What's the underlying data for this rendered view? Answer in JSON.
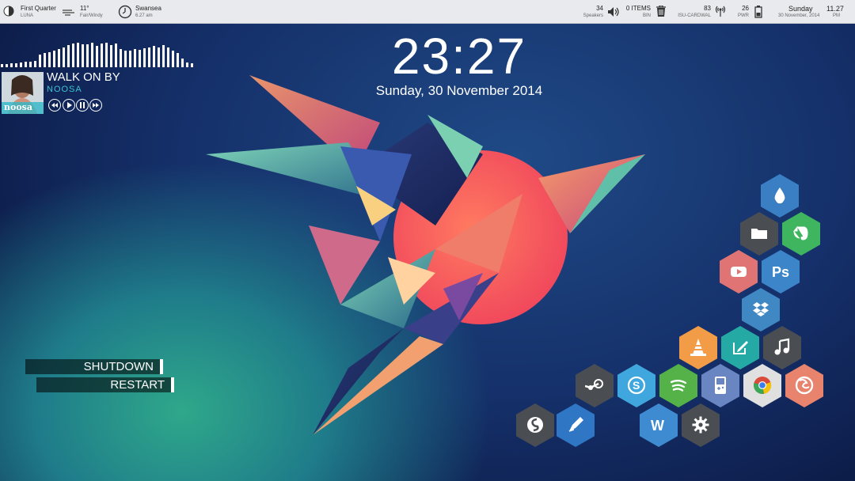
{
  "topbar": {
    "moon": {
      "title": "First Quarter",
      "sub": "LUNA"
    },
    "weather": {
      "title": "11°",
      "sub": "Fair/Windy"
    },
    "location": {
      "title": "Swansea",
      "sub": "6.27 am"
    },
    "speakers": {
      "value": "34",
      "sub": "Speakers"
    },
    "bin": {
      "value": "0 ITEMS",
      "sub": "BIN"
    },
    "wifi": {
      "value": "83",
      "sub": "ISU-CARDWAL"
    },
    "power": {
      "value": "26",
      "sub": "PWR"
    },
    "day": {
      "title": "Sunday",
      "sub": "30 November, 2014"
    },
    "time": {
      "title": "11.27",
      "sub": "PM"
    }
  },
  "clock": {
    "time": "23:27",
    "date": "Sunday, 30 November 2014"
  },
  "music": {
    "title": "WALK ON BY",
    "artist": "NOOSA",
    "art_text": "noosa"
  },
  "power_menu": {
    "shutdown": "SHUTDOWN",
    "restart": "RESTART"
  },
  "launcher": [
    {
      "name": "water-icon",
      "color": "#3a7fc4"
    },
    {
      "name": "folder-icon",
      "color": "#4a4d52"
    },
    {
      "name": "evernote-icon",
      "color": "#3fb55f"
    },
    {
      "name": "youtube-icon",
      "color": "#e07475"
    },
    {
      "name": "photoshop-icon",
      "color": "#3b85c8"
    },
    {
      "name": "dropbox-icon",
      "color": "#3f88c4"
    },
    {
      "name": "vlc-icon",
      "color": "#f29c47"
    },
    {
      "name": "edit-icon",
      "color": "#24a9a4"
    },
    {
      "name": "music-icon",
      "color": "#4a4d52"
    },
    {
      "name": "steam-icon",
      "color": "#4a4d52"
    },
    {
      "name": "skype-icon",
      "color": "#3fa7de"
    },
    {
      "name": "spotify-icon",
      "color": "#54b248"
    },
    {
      "name": "gameboy-icon",
      "color": "#6a86c2"
    },
    {
      "name": "chrome-icon",
      "color": "#e0e0e0"
    },
    {
      "name": "firefox-icon",
      "color": "#e8836e"
    },
    {
      "name": "simplenote-icon",
      "color": "#4a4d52"
    },
    {
      "name": "writer-icon",
      "color": "#2f76c5"
    },
    {
      "name": "word-icon",
      "color": "#3f8bd2"
    },
    {
      "name": "settings-icon",
      "color": "#4a4d52"
    }
  ]
}
